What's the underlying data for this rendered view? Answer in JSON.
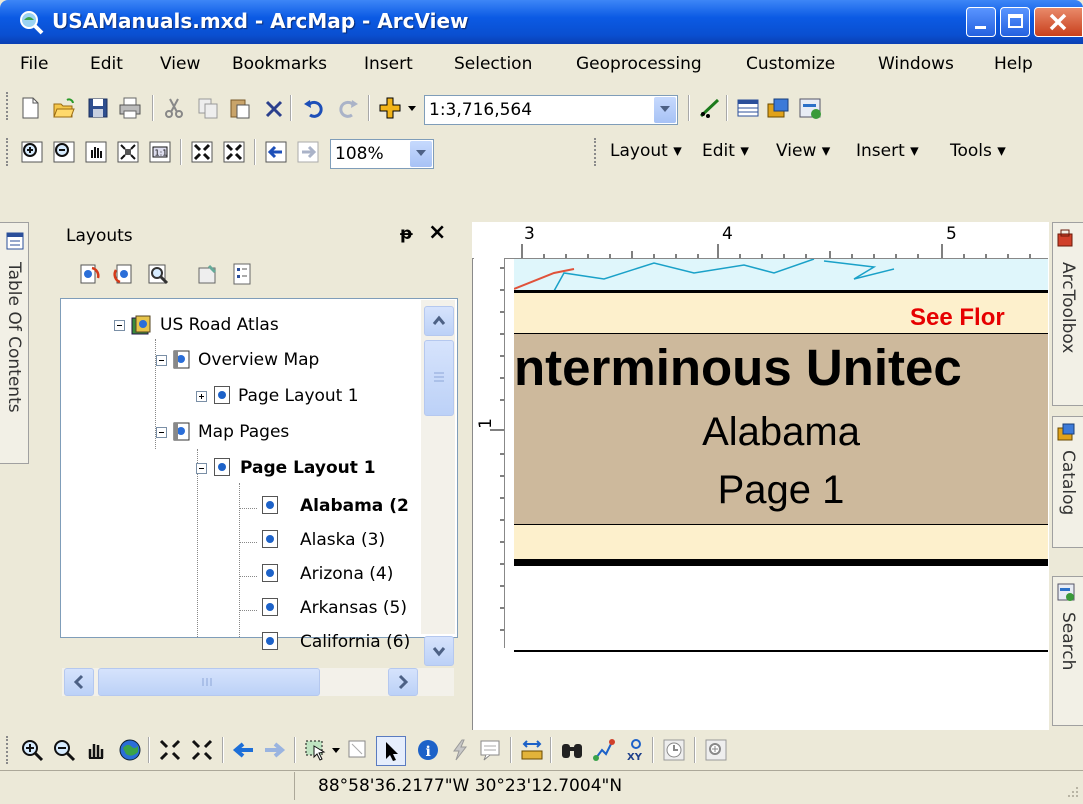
{
  "window": {
    "title": "USAManuals.mxd - ArcMap - ArcView",
    "controls": [
      "minimize",
      "maximize",
      "close"
    ]
  },
  "menubar": {
    "items": [
      "File",
      "Edit",
      "View",
      "Bookmarks",
      "Insert",
      "Selection",
      "Geoprocessing",
      "Customize",
      "Windows",
      "Help"
    ]
  },
  "standard_toolbar": {
    "scale_value": "1:3,716,564",
    "icons": [
      "new-document-icon",
      "open-icon",
      "save-icon",
      "print-icon",
      "cut-icon",
      "copy-icon",
      "paste-icon",
      "delete-icon",
      "undo-icon",
      "redo-icon",
      "add-data-icon",
      "editor-icon",
      "table-icon",
      "arctoolbox-icon",
      "python-icon"
    ]
  },
  "layout_toolbar": {
    "zoom_value": "108%",
    "menus": [
      "Layout ▾",
      "Edit ▾",
      "View ▾",
      "Insert ▾",
      "Tools ▾"
    ],
    "icons": [
      "zoom-in-page-icon",
      "zoom-out-page-icon",
      "pan-page-icon",
      "zoom-whole-page-icon",
      "zoom-100-icon",
      "fixed-zoom-in-icon",
      "fixed-zoom-out-icon",
      "back-extent-icon",
      "forward-extent-icon"
    ]
  },
  "toc": {
    "tab_label": "Table Of Contents"
  },
  "layouts_panel": {
    "title": "Layouts",
    "pin": "ᵽ",
    "close": "×",
    "toolbar_icons": [
      "refresh-icon",
      "reset-icon",
      "zoom-layout-icon",
      "properties-icon",
      "list-icon"
    ],
    "tree": [
      {
        "label": "US Road Atlas",
        "level": 0,
        "expander": "minus",
        "bold": false
      },
      {
        "label": "Overview Map",
        "level": 1,
        "expander": "minus",
        "bold": false
      },
      {
        "label": "Page Layout 1",
        "level": 2,
        "expander": "plus",
        "bold": false
      },
      {
        "label": "Map Pages",
        "level": 1,
        "expander": "minus",
        "bold": false
      },
      {
        "label": "Page Layout 1",
        "level": 2,
        "expander": "minus",
        "bold": true
      },
      {
        "label": "Alabama (2",
        "level": 3,
        "expander": "",
        "bold": true
      },
      {
        "label": "Alaska (3)",
        "level": 3,
        "expander": "",
        "bold": false
      },
      {
        "label": "Arizona (4)",
        "level": 3,
        "expander": "",
        "bold": false
      },
      {
        "label": "Arkansas (5)",
        "level": 3,
        "expander": "",
        "bold": false
      },
      {
        "label": "California (6)",
        "level": 3,
        "expander": "",
        "bold": false
      }
    ]
  },
  "layout_view": {
    "ruler_top_labels": [
      "3",
      "4",
      "5"
    ],
    "ruler_left_label": "1",
    "see_text": "See Flor",
    "headline": "nterminous Unitec",
    "state": "Alabama",
    "page": "Page 1",
    "colors": {
      "band": "#cdb99c",
      "band_light": "#fdf0cc",
      "water": "#dff6fb",
      "red_text": "#e60000"
    }
  },
  "right_dock": {
    "tabs": [
      "ArcToolbox",
      "Catalog",
      "Search"
    ]
  },
  "tools_toolbar": {
    "icons": [
      "zoom-in-icon",
      "zoom-out-icon",
      "pan-icon",
      "full-extent-icon",
      "fixed-zoom-in-icon",
      "fixed-zoom-out-icon",
      "back-icon",
      "forward-icon",
      "select-features-icon",
      "clear-selection-icon",
      "select-elements-icon",
      "identify-icon",
      "hyperlink-icon",
      "html-popup-icon",
      "measure-icon",
      "find-icon",
      "find-route-icon",
      "go-to-xy-icon",
      "time-slider-icon",
      "create-viewer-icon"
    ]
  },
  "status": {
    "coords": "88°58'36.2177\"W  30°23'12.7004\"N"
  }
}
